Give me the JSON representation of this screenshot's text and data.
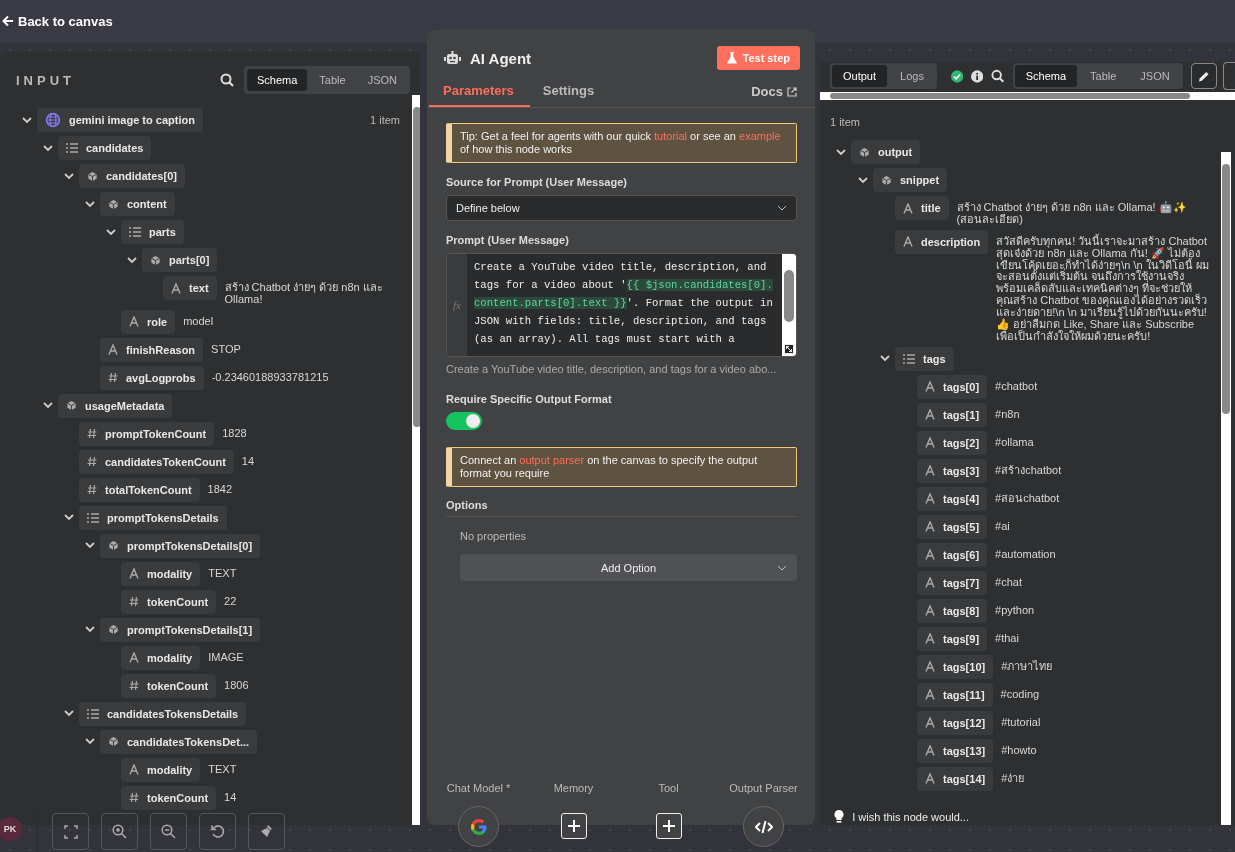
{
  "top_bar": {
    "back_label": "Back to canvas"
  },
  "input_panel": {
    "title": "INPUT",
    "view_tabs": [
      {
        "label": "Schema",
        "selected": true
      },
      {
        "label": "Table",
        "selected": false
      },
      {
        "label": "JSON",
        "selected": false
      }
    ],
    "tree": [
      {
        "key": "gemini image to caption",
        "kind": "service",
        "count": "1 item",
        "expanded": true,
        "children": [
          {
            "key": "candidates",
            "kind": "array",
            "expanded": true,
            "children": [
              {
                "key": "candidates[0]",
                "kind": "object",
                "expanded": true,
                "children": [
                  {
                    "key": "content",
                    "kind": "object",
                    "expanded": true,
                    "children": [
                      {
                        "key": "parts",
                        "kind": "array",
                        "expanded": true,
                        "children": [
                          {
                            "key": "parts[0]",
                            "kind": "object",
                            "expanded": true,
                            "children": [
                              {
                                "key": "text",
                                "kind": "string",
                                "value": "สร้าง Chatbot ง่ายๆ ด้วย n8n และ Ollama!"
                              }
                            ]
                          }
                        ]
                      },
                      {
                        "key": "role",
                        "kind": "string",
                        "value": "model"
                      }
                    ]
                  },
                  {
                    "key": "finishReason",
                    "kind": "string",
                    "value": "STOP"
                  },
                  {
                    "key": "avgLogprobs",
                    "kind": "number",
                    "value": "-0.23460188933781215"
                  }
                ]
              }
            ]
          },
          {
            "key": "usageMetadata",
            "kind": "object",
            "expanded": true,
            "children": [
              {
                "key": "promptTokenCount",
                "kind": "number",
                "value": "1828"
              },
              {
                "key": "candidatesTokenCount",
                "kind": "number",
                "value": "14"
              },
              {
                "key": "totalTokenCount",
                "kind": "number",
                "value": "1842"
              },
              {
                "key": "promptTokensDetails",
                "kind": "array",
                "expanded": true,
                "children": [
                  {
                    "key": "promptTokensDetails[0]",
                    "kind": "object",
                    "expanded": true,
                    "children": [
                      {
                        "key": "modality",
                        "kind": "string",
                        "value": "TEXT"
                      },
                      {
                        "key": "tokenCount",
                        "kind": "number",
                        "value": "22"
                      }
                    ]
                  },
                  {
                    "key": "promptTokensDetails[1]",
                    "kind": "object",
                    "expanded": true,
                    "children": [
                      {
                        "key": "modality",
                        "kind": "string",
                        "value": "IMAGE"
                      },
                      {
                        "key": "tokenCount",
                        "kind": "number",
                        "value": "1806"
                      }
                    ]
                  }
                ]
              },
              {
                "key": "candidatesTokensDetails",
                "kind": "array",
                "expanded": true,
                "children": [
                  {
                    "key": "candidatesTokensDet...",
                    "kind": "object",
                    "expanded": true,
                    "children": [
                      {
                        "key": "modality",
                        "kind": "string",
                        "value": "TEXT"
                      },
                      {
                        "key": "tokenCount",
                        "kind": "number",
                        "value": "14"
                      }
                    ]
                  }
                ]
              }
            ]
          }
        ]
      }
    ]
  },
  "node_panel": {
    "title": "AI Agent",
    "test_button": "Test step",
    "tabs": [
      {
        "label": "Parameters",
        "selected": true
      },
      {
        "label": "Settings",
        "selected": false
      }
    ],
    "docs_link": "Docs",
    "tip": [
      {
        "text": "Tip: Get a feel for agents with our quick ",
        "link": false
      },
      {
        "text": "tutorial",
        "link": true
      },
      {
        "text": " or see an ",
        "link": false
      },
      {
        "text": "example",
        "link": true
      },
      {
        "text": " of how this node works",
        "link": false
      }
    ],
    "source_field": {
      "label": "Source for Prompt (User Message)",
      "value": "Define below"
    },
    "prompt_field": {
      "label": "Prompt (User Message)",
      "gutter": "fx",
      "segments": [
        {
          "text": "Create a YouTube video title, description, and tags for a video about '",
          "kind": "plain"
        },
        {
          "text": "{{ $json.candidates[0].content.parts[0].text }}",
          "kind": "expression"
        },
        {
          "text": "'. Format the output in JSON with fields: title, description, and tags (as an array). All tags must start with a",
          "kind": "plain"
        }
      ],
      "preview": "Create a YouTube video title, description, and tags for a video abo..."
    },
    "output_format_toggle": {
      "label": "Require Specific Output Format",
      "on": true
    },
    "parser_notice": [
      {
        "text": "Connect an ",
        "link": false
      },
      {
        "text": "output parser",
        "link": true
      },
      {
        "text": " on the canvas to specify the output format you require",
        "link": false
      }
    ],
    "options": {
      "title": "Options",
      "empty_text": "No properties",
      "add_button": "Add Option"
    },
    "connectors": [
      {
        "label": "Chat Model *",
        "kind": "model"
      },
      {
        "label": "Memory",
        "kind": "add"
      },
      {
        "label": "Tool",
        "kind": "add"
      },
      {
        "label": "Output Parser",
        "kind": "parser"
      }
    ]
  },
  "output_panel": {
    "mode_tabs": [
      {
        "label": "Output",
        "selected": true
      },
      {
        "label": "Logs",
        "selected": false
      }
    ],
    "view_tabs": [
      {
        "label": "Schema",
        "selected": true
      },
      {
        "label": "Table",
        "selected": false
      },
      {
        "label": "JSON",
        "selected": false
      }
    ],
    "count": "1 item",
    "tree": [
      {
        "key": "output",
        "kind": "object",
        "expanded": true,
        "children": [
          {
            "key": "snippet",
            "kind": "object",
            "expanded": true,
            "children": [
              {
                "key": "title",
                "kind": "string",
                "value": "สร้าง Chatbot ง่ายๆ ด้วย n8n และ Ollama! 🤖✨ (สอนละเอียด)"
              },
              {
                "key": "description",
                "kind": "string",
                "value": "สวัสดีครับทุกคน! วันนี้เราจะมาสร้าง Chatbot สุดเจ๋งด้วย n8n และ Ollama กัน! 🚀 ไม่ต้องเขียนโค้ดเยอะก็ทำได้ง่ายๆ\\n \\n ในวิดีโอนี้ ผมจะสอนตั้งแต่เริ่มต้น จนถึงการใช้งานจริง พร้อมเคล็ดลับและเทคนิคต่างๆ ที่จะช่วยให้คุณสร้าง Chatbot ของคุณเองได้อย่างรวดเร็วและง่ายดาย!\\n \\n มาเรียนรู้ไปด้วยกันนะครับ! 👍 อย่าลืมกด Like, Share และ Subscribe เพื่อเป็นกำลังใจให้ผมด้วยนะครับ!"
              },
              {
                "key": "tags",
                "kind": "array",
                "expanded": true,
                "children": [
                  {
                    "key": "tags[0]",
                    "kind": "string",
                    "value": "#chatbot"
                  },
                  {
                    "key": "tags[1]",
                    "kind": "string",
                    "value": "#n8n"
                  },
                  {
                    "key": "tags[2]",
                    "kind": "string",
                    "value": "#ollama"
                  },
                  {
                    "key": "tags[3]",
                    "kind": "string",
                    "value": "#สร้างchatbot"
                  },
                  {
                    "key": "tags[4]",
                    "kind": "string",
                    "value": "#สอนchatbot"
                  },
                  {
                    "key": "tags[5]",
                    "kind": "string",
                    "value": "#ai"
                  },
                  {
                    "key": "tags[6]",
                    "kind": "string",
                    "value": "#automation"
                  },
                  {
                    "key": "tags[7]",
                    "kind": "string",
                    "value": "#chat"
                  },
                  {
                    "key": "tags[8]",
                    "kind": "string",
                    "value": "#python"
                  },
                  {
                    "key": "tags[9]",
                    "kind": "string",
                    "value": "#thai"
                  },
                  {
                    "key": "tags[10]",
                    "kind": "string",
                    "value": "#ภาษาไทย"
                  },
                  {
                    "key": "tags[11]",
                    "kind": "string",
                    "value": "#coding"
                  },
                  {
                    "key": "tags[12]",
                    "kind": "string",
                    "value": "#tutorial"
                  },
                  {
                    "key": "tags[13]",
                    "kind": "string",
                    "value": "#howto"
                  },
                  {
                    "key": "tags[14]",
                    "kind": "string",
                    "value": "#ง่าย"
                  }
                ]
              }
            ]
          }
        ]
      }
    ]
  },
  "canvas_bar": {
    "avatar": "PK",
    "tools": [
      {
        "kind": "fit"
      },
      {
        "kind": "zoom-in"
      },
      {
        "kind": "zoom-out"
      },
      {
        "kind": "reset"
      },
      {
        "kind": "clear"
      }
    ],
    "feedback": "I wish this node would..."
  }
}
